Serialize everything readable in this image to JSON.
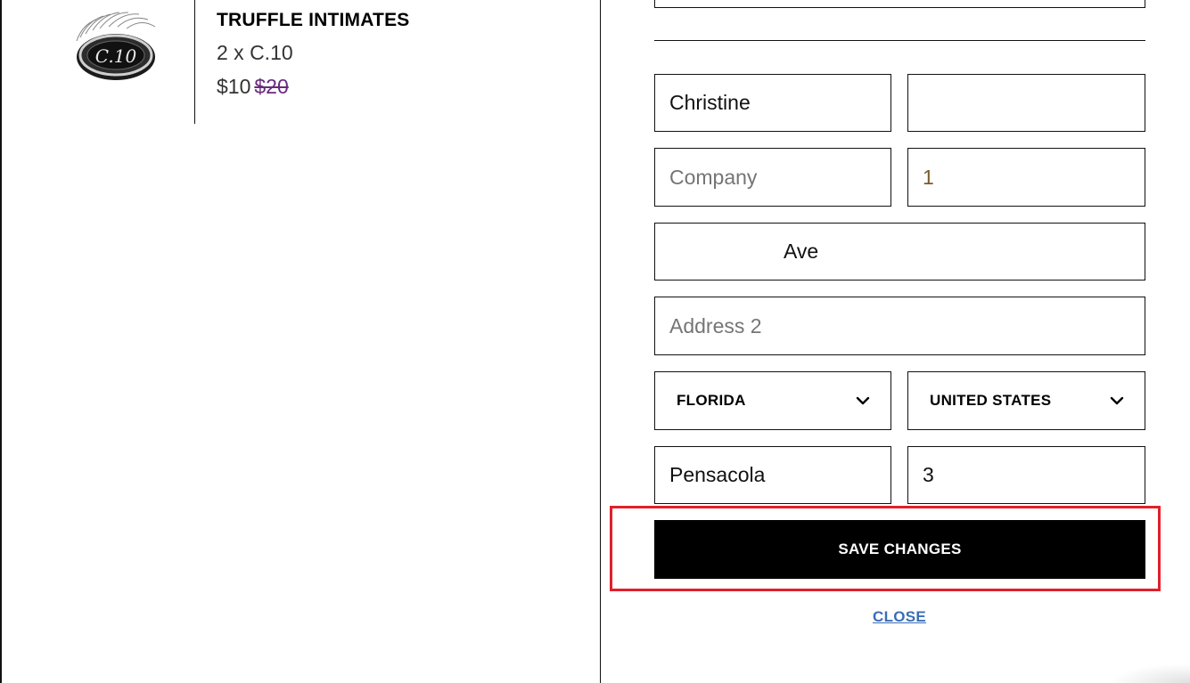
{
  "product": {
    "image_label": "C.10",
    "name": "TRUFFLE INTIMATES",
    "variant": "2 x C.10",
    "price": "$10",
    "original_price": "$20"
  },
  "form": {
    "first_name": {
      "value": "Christine",
      "placeholder": ""
    },
    "last_name": {
      "value": "",
      "placeholder": ""
    },
    "company": {
      "value": "",
      "placeholder": "Company"
    },
    "phone": {
      "value": "1",
      "placeholder": ""
    },
    "address1": {
      "value": "Ave",
      "placeholder": ""
    },
    "address2": {
      "value": "",
      "placeholder": "Address 2"
    },
    "state": {
      "selected": "FLORIDA"
    },
    "country": {
      "selected": "UNITED STATES"
    },
    "city": {
      "value": "Pensacola",
      "placeholder": ""
    },
    "zip": {
      "value": "3",
      "placeholder": ""
    }
  },
  "actions": {
    "save_label": "SAVE CHANGES",
    "close_label": "CLOSE"
  },
  "colors": {
    "highlight": "#e0202a",
    "link": "#3a6db5",
    "strike_price": "#6a2a7d"
  }
}
